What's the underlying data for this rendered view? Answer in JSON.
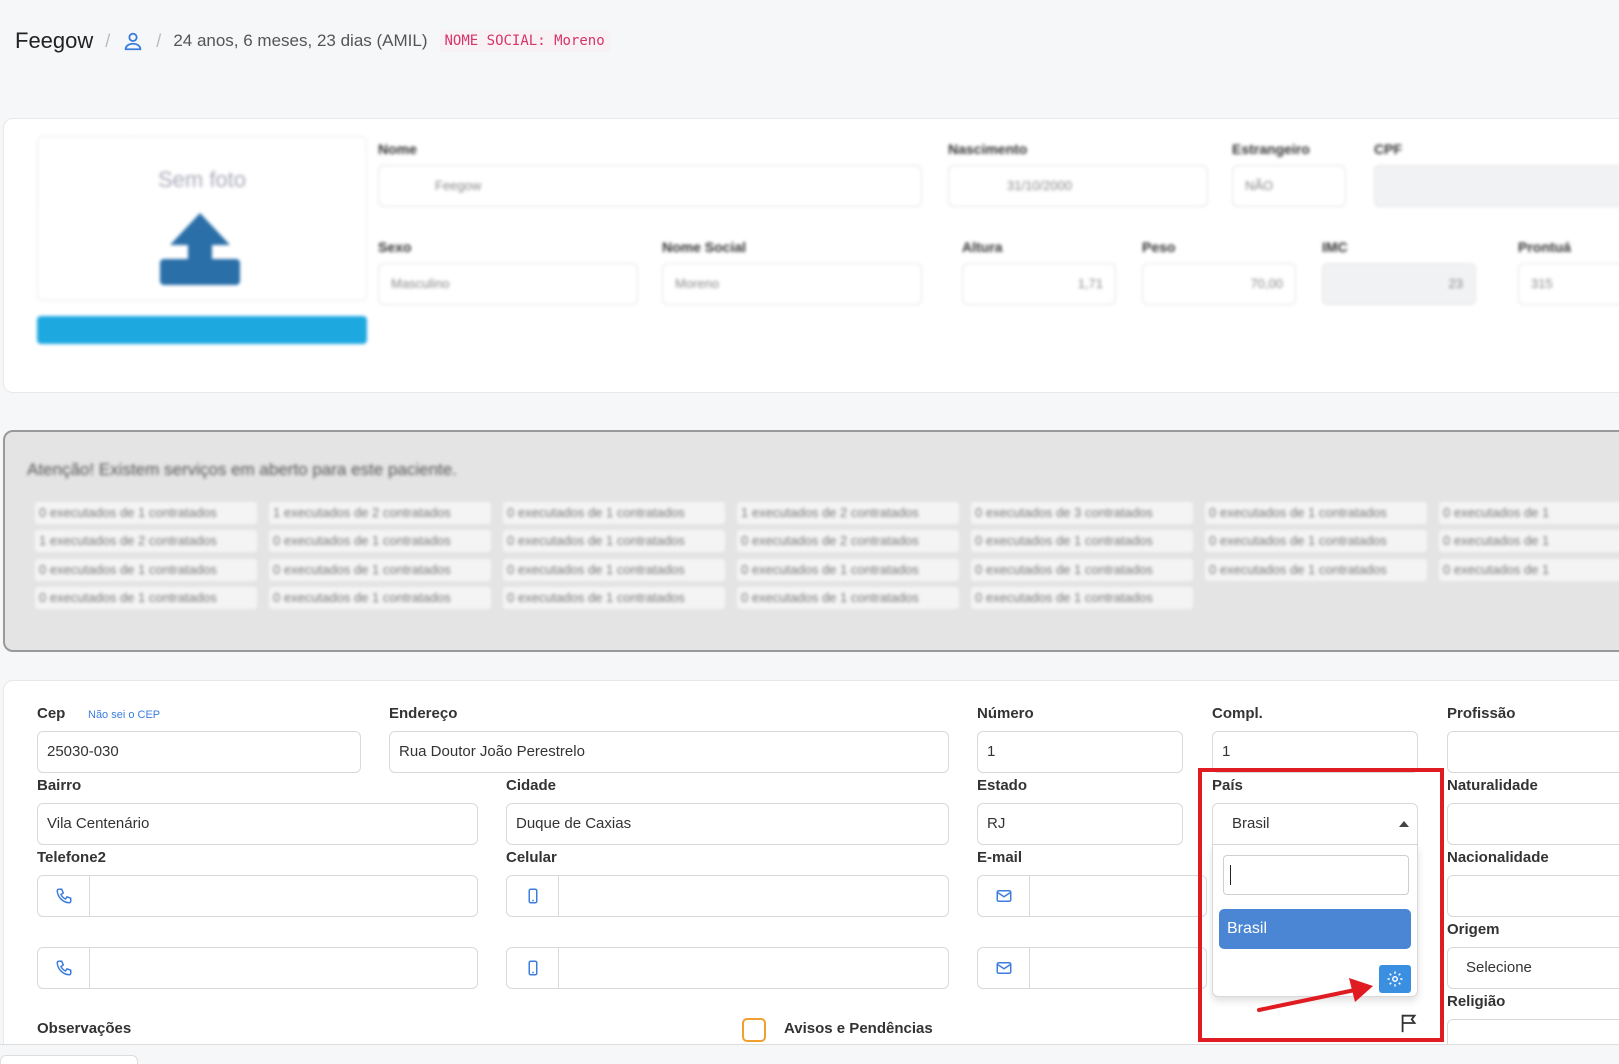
{
  "breadcrumb": {
    "brand": "Feegow",
    "separator": "/",
    "info": "24 anos, 6 meses, 23 dias (AMIL)",
    "social_name_badge": "NOME SOCIAL: Moreno"
  },
  "patient_card": {
    "photo_text": "Sem foto",
    "fields": {
      "nome_label": "Nome",
      "nome_value": "Feegow",
      "nascimento_label": "Nascimento",
      "nascimento_value": "31/10/2000",
      "estrangeiro_label": "Estrangeiro",
      "estrangeiro_value": "NÃO",
      "cpf_label": "CPF",
      "sexo_label": "Sexo",
      "sexo_value": "Masculino",
      "nome_social_label": "Nome Social",
      "nome_social_value": "Moreno",
      "altura_label": "Altura",
      "altura_value": "1,71",
      "peso_label": "Peso",
      "peso_value": "70,00",
      "imc_label": "IMC",
      "imc_value": "23",
      "prontuario_label": "Prontuá",
      "prontuario_value": "315"
    }
  },
  "alert": {
    "title": "Atenção! Existem serviços em aberto para este paciente.",
    "chips": [
      "0 executados de 1 contratados",
      "1 executados de 2 contratados",
      "0 executados de 1 contratados",
      "1 executados de 2 contratados",
      "0 executados de 3 contratados",
      "0 executados de 1 contratados",
      "0 executados de 1",
      "1 executados de 2 contratados",
      "0 executados de 1 contratados",
      "0 executados de 1 contratados",
      "0 executados de 2 contratados",
      "0 executados de 1 contratados",
      "0 executados de 1 contratados",
      "0 executados de 1",
      "0 executados de 1 contratados",
      "0 executados de 1 contratados",
      "0 executados de 1 contratados",
      "0 executados de 1 contratados",
      "0 executados de 1 contratados",
      "0 executados de 1 contratados",
      "0 executados de 1",
      "0 executados de 1 contratados",
      "0 executados de 1 contratados",
      "0 executados de 1 contratados",
      "0 executados de 1 contratados",
      "0 executados de 1 contratados"
    ]
  },
  "address": {
    "cep_label": "Cep",
    "cep_link": "Não sei o CEP",
    "cep_value": "25030-030",
    "endereco_label": "Endereço",
    "endereco_value": "Rua Doutor João Perestrelo",
    "numero_label": "Número",
    "numero_value": "1",
    "compl_label": "Compl.",
    "compl_value": "1",
    "profissao_label": "Profissão",
    "bairro_label": "Bairro",
    "bairro_value": "Vila Centenário",
    "cidade_label": "Cidade",
    "cidade_value": "Duque de Caxias",
    "estado_label": "Estado",
    "estado_value": "RJ",
    "pais_label": "País",
    "pais_value": "Brasil",
    "naturalidade_label": "Naturalidade",
    "telefone2_label": "Telefone2",
    "celular_label": "Celular",
    "email_label": "E-mail",
    "nacionalidade_label": "Nacionalidade",
    "origem_label": "Origem",
    "origem_value": "Selecione",
    "religiao_label": "Religião",
    "observacoes_label": "Observações",
    "avisos_label": "Avisos e Pendências"
  },
  "dropdown": {
    "search_value": "",
    "options": [
      "Brasil"
    ]
  },
  "colors": {
    "accent": "#4a86d4",
    "highlight_box": "#e01b22",
    "photo_button": "#1ea8e0",
    "checkbox_border": "#f0a030"
  },
  "icons": [
    "user-icon",
    "search-icon",
    "calendar-icon",
    "upload-icon",
    "phone-icon",
    "mobile-icon",
    "envelope-icon",
    "gear-icon",
    "flag-icon",
    "caret-up-icon"
  ]
}
